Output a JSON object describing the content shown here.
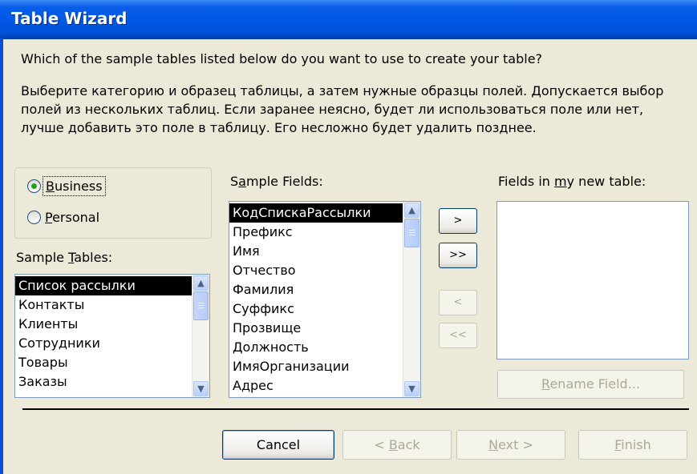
{
  "window": {
    "title": "Table Wizard"
  },
  "question": "Which of the sample tables listed below do you want to use to create your table?",
  "description": "Выберите категорию и образец таблицы, а затем нужные образцы полей. Допускается выбор полей из нескольких таблиц. Если заранее неясно, будет ли использоваться поле или нет, лучше добавить это поле в таблицу. Его несложно будет удалить позднее.",
  "category": {
    "business": {
      "pre": "",
      "key": "B",
      "post": "usiness",
      "checked": true
    },
    "personal": {
      "pre": "",
      "key": "P",
      "post": "ersonal",
      "checked": false
    }
  },
  "sample_tables": {
    "label_pre": "Sample ",
    "label_key": "T",
    "label_post": "ables:",
    "items": [
      "Список рассылки",
      "Контакты",
      "Клиенты",
      "Сотрудники",
      "Товары",
      "Заказы"
    ],
    "selected_index": 0
  },
  "sample_fields": {
    "label_pre": "S",
    "label_key": "a",
    "label_post": "mple Fields:",
    "items": [
      "КодСпискаРассылки",
      "Префикс",
      "Имя",
      "Отчество",
      "Фамилия",
      "Суффикс",
      "Прозвище",
      "Должность",
      "ИмяОрганизации",
      "Адрес"
    ],
    "selected_index": 0
  },
  "new_table_fields": {
    "label_pre": "Fields in ",
    "label_key": "m",
    "label_post": "y new table:",
    "items": []
  },
  "move_buttons": {
    "add_one": ">",
    "add_all": ">>",
    "remove_one": "<",
    "remove_all": "<<"
  },
  "rename_button": {
    "pre": "",
    "key": "R",
    "post": "ename Field..."
  },
  "footer": {
    "cancel": "Cancel",
    "back": {
      "pre": "< ",
      "key": "B",
      "post": "ack"
    },
    "next": {
      "pre": "",
      "key": "N",
      "post": "ext >"
    },
    "finish": {
      "pre": "",
      "key": "F",
      "post": "inish"
    }
  },
  "colors": {
    "titlebar": "#0058e6",
    "dialog_bg": "#ece9d8",
    "selection_bg": "#000000",
    "radio_dot": "#21a121"
  }
}
